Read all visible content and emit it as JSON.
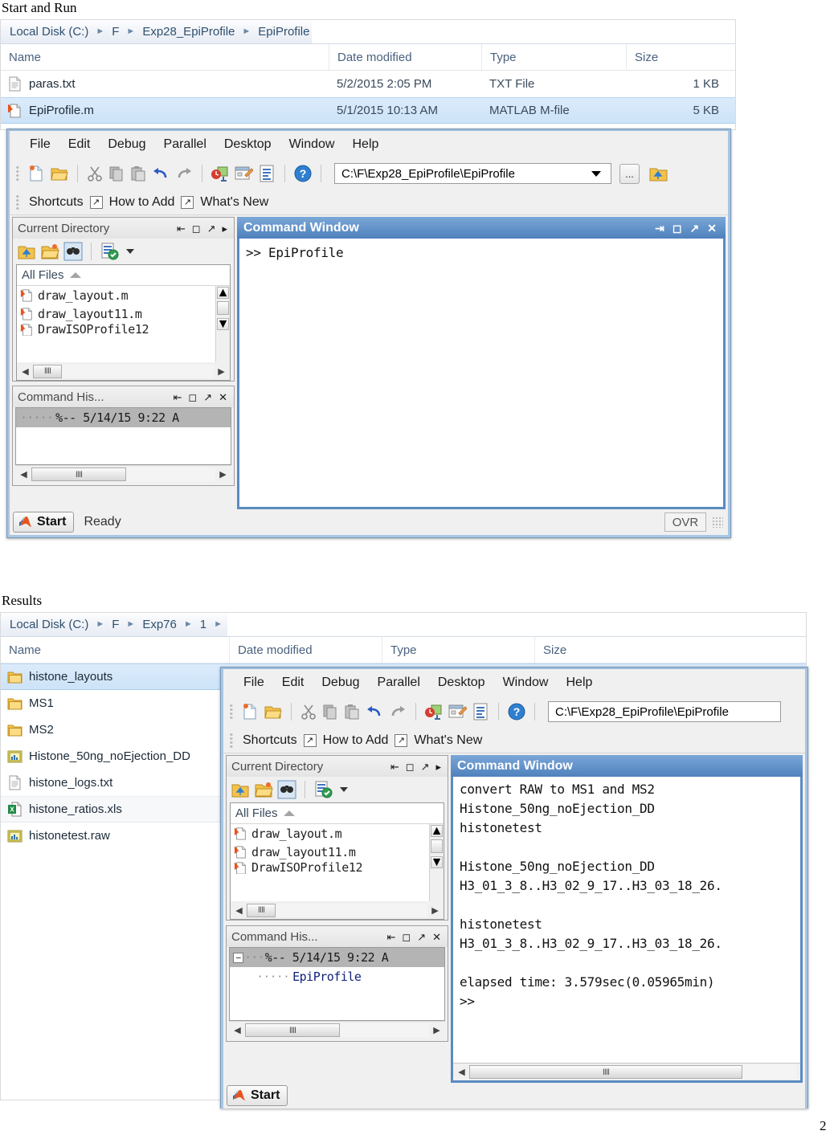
{
  "document": {
    "heading_1": "Start and Run",
    "heading_2": "Results",
    "page_number": "2"
  },
  "explorer_1": {
    "breadcrumbs": [
      "Local Disk (C:)",
      "F",
      "Exp28_EpiProfile",
      "EpiProfile"
    ],
    "columns": [
      "Name",
      "Date modified",
      "Type",
      "Size"
    ],
    "rows": [
      {
        "icon": "txt-file-icon",
        "name": "paras.txt",
        "date": "5/2/2015 2:05 PM",
        "type": "TXT File",
        "size": "1 KB",
        "state": "normal"
      },
      {
        "icon": "matlab-m-file-icon",
        "name": "EpiProfile.m",
        "date": "5/1/2015 10:13 AM",
        "type": "MATLAB M-file",
        "size": "5 KB",
        "state": "selected"
      }
    ]
  },
  "explorer_2": {
    "breadcrumbs": [
      "Local Disk (C:)",
      "F",
      "Exp76",
      "1"
    ],
    "columns": [
      "Name",
      "Date modified",
      "Type",
      "Size"
    ],
    "rows": [
      {
        "icon": "folder-icon",
        "name": "histone_layouts",
        "state": "selected"
      },
      {
        "icon": "folder-icon",
        "name": "MS1",
        "state": "normal"
      },
      {
        "icon": "folder-icon",
        "name": "MS2",
        "state": "normal"
      },
      {
        "icon": "raw-data-icon",
        "name": "Histone_50ng_noEjection_DD",
        "state": "normal"
      },
      {
        "icon": "txt-file-icon",
        "name": "histone_logs.txt",
        "state": "normal"
      },
      {
        "icon": "excel-file-icon",
        "name": "histone_ratios.xls",
        "state": "hover"
      },
      {
        "icon": "raw-data-icon",
        "name": "histonetest.raw",
        "state": "normal"
      }
    ]
  },
  "matlab_1": {
    "menus": [
      "File",
      "Edit",
      "Debug",
      "Parallel",
      "Desktop",
      "Window",
      "Help"
    ],
    "toolbar_icons": [
      "new-file-icon",
      "open-folder-icon",
      "cut-icon",
      "copy-icon",
      "paste-icon",
      "undo-icon",
      "redo-icon",
      "simulink-icon",
      "guide-icon",
      "profiler-icon",
      "help-icon"
    ],
    "path_value": "C:\\F\\Exp28_EpiProfile\\EpiProfile",
    "browse_button": "...",
    "up_folder_icon": "up-folder-icon",
    "shortcuts_bar": [
      "Shortcuts",
      "How to Add",
      "What's New"
    ],
    "current_directory": {
      "title": "Current Directory",
      "toolbar_icons": [
        "up-folder-icon",
        "new-folder-icon",
        "find-files-icon",
        "validate-path-icon"
      ],
      "filter_label": "All Files",
      "files": [
        "draw_layout.m",
        "draw_layout11.m",
        "DrawISOProfile12"
      ]
    },
    "command_history": {
      "title": "Command His...",
      "entries": [
        {
          "text": "%-- 5/14/15   9:22 A",
          "selected": true
        }
      ]
    },
    "command_window": {
      "title": "Command Window",
      "lines": [
        ">> EpiProfile"
      ]
    },
    "status": {
      "start_label": "Start",
      "ready_label": "Ready",
      "ovr_label": "OVR"
    }
  },
  "matlab_2": {
    "menus": [
      "File",
      "Edit",
      "Debug",
      "Parallel",
      "Desktop",
      "Window",
      "Help"
    ],
    "path_value": "C:\\F\\Exp28_EpiProfile\\EpiProfile",
    "shortcuts_bar": [
      "Shortcuts",
      "How to Add",
      "What's New"
    ],
    "current_directory": {
      "title": "Current Directory",
      "filter_label": "All Files",
      "files": [
        "draw_layout.m",
        "draw_layout11.m",
        "DrawISOProfile12"
      ]
    },
    "command_history": {
      "title": "Command His...",
      "entries": [
        {
          "text": "%-- 5/14/15   9:22 A",
          "selected": true
        },
        {
          "text": "EpiProfile",
          "selected": false
        }
      ]
    },
    "command_window": {
      "title": "Command Window",
      "lines": [
        "convert RAW to MS1 and MS2",
        "Histone_50ng_noEjection_DD",
        "histonetest",
        "",
        "Histone_50ng_noEjection_DD",
        "H3_01_3_8..H3_02_9_17..H3_03_18_26.",
        "",
        "histonetest",
        "H3_01_3_8..H3_02_9_17..H3_03_18_26.",
        "",
        "elapsed time: 3.579sec(0.05965min)",
        ">>"
      ]
    },
    "status": {
      "start_label": "Start"
    }
  },
  "colors": {
    "selection_blue": "#cde3f8",
    "title_blue": "#4f81bd",
    "breadcrumb_text": "#30506e",
    "folder_yellow": "#f5c44a"
  }
}
